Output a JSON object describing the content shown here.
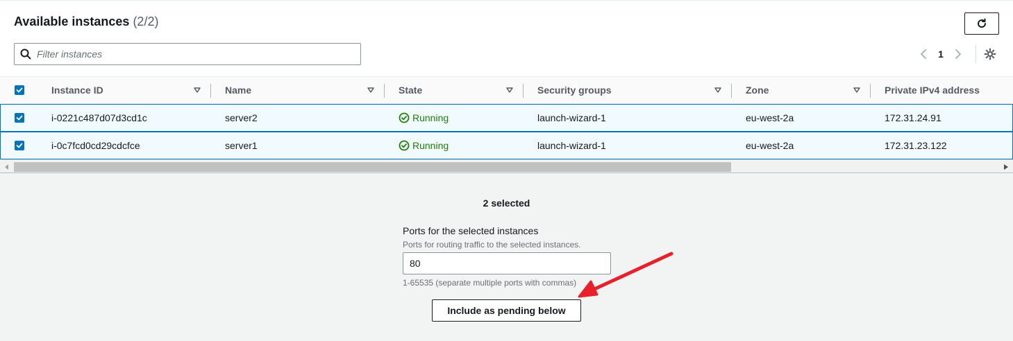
{
  "header": {
    "title": "Available instances",
    "count": "(2/2)"
  },
  "filter": {
    "placeholder": "Filter instances",
    "value": ""
  },
  "pagination": {
    "current_page": "1"
  },
  "table": {
    "columns": [
      "Instance ID",
      "Name",
      "State",
      "Security groups",
      "Zone",
      "Private IPv4 address"
    ],
    "rows": [
      {
        "instance_id": "i-0221c487d07d3cd1c",
        "name": "server2",
        "state": "Running",
        "security_groups": "launch-wizard-1",
        "zone": "eu-west-2a",
        "private_ipv4": "172.31.24.91",
        "selected": true
      },
      {
        "instance_id": "i-0c7fcd0cd29cdcfce",
        "name": "server1",
        "state": "Running",
        "security_groups": "launch-wizard-1",
        "zone": "eu-west-2a",
        "private_ipv4": "172.31.23.122",
        "selected": true
      }
    ]
  },
  "selection": {
    "summary": "2 selected"
  },
  "ports": {
    "label": "Ports for the selected instances",
    "description": "Ports for routing traffic to the selected instances.",
    "value": "80",
    "hint": "1-65535 (separate multiple ports with commas)"
  },
  "actions": {
    "include_label": "Include as pending below"
  },
  "colors": {
    "accent_blue": "#0073bb",
    "running_green": "#1d8102",
    "annotation_red": "#e8202a"
  }
}
